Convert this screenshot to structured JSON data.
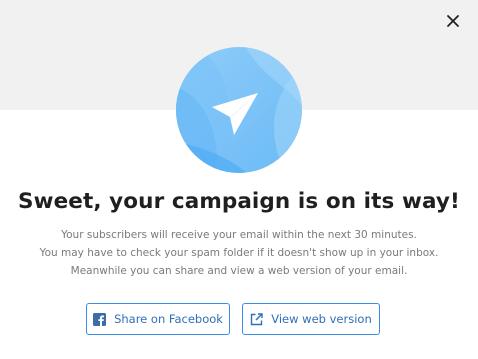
{
  "headline": "Sweet, your campaign is on its way!",
  "body_lines": [
    "Your subscribers will receive your email within the next 30 minutes.",
    "You may have to check your spam folder if it doesn't show up in your inbox.",
    "Meanwhile you can share and view a web version of your email."
  ],
  "buttons": {
    "share_facebook": "Share on Facebook",
    "view_web_version": "View web version"
  },
  "icons": {
    "close": "close-icon",
    "hero": "paper-plane-icon",
    "facebook": "facebook-icon",
    "external_link": "external-link-icon"
  },
  "colors": {
    "accent": "#3a8ee6",
    "hero_light": "#8fcdf9",
    "hero_dark": "#4aa8f3",
    "headline": "#1f1f1f",
    "body": "#7a7a7a",
    "top_band": "#f1f1f1"
  }
}
